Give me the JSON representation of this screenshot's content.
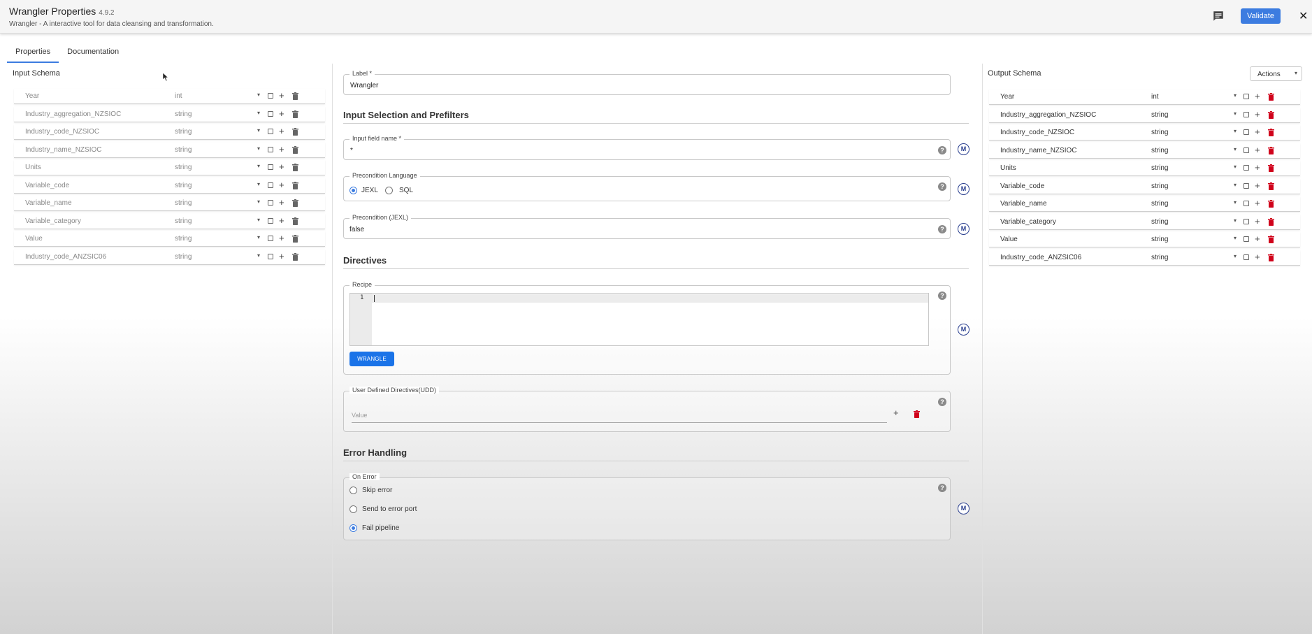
{
  "header": {
    "title": "Wrangler Properties",
    "version": "4.9.2",
    "subtitle": "Wrangler - A interactive tool for data cleansing and transformation.",
    "validate_label": "Validate",
    "close_label": "✕"
  },
  "tabs": [
    {
      "label": "Properties",
      "active": true
    },
    {
      "label": "Documentation",
      "active": false
    }
  ],
  "input_schema": {
    "title": "Input Schema",
    "rows": [
      {
        "name": "Year",
        "type": "int"
      },
      {
        "name": "Industry_aggregation_NZSIOC",
        "type": "string"
      },
      {
        "name": "Industry_code_NZSIOC",
        "type": "string"
      },
      {
        "name": "Industry_name_NZSIOC",
        "type": "string"
      },
      {
        "name": "Units",
        "type": "string"
      },
      {
        "name": "Variable_code",
        "type": "string"
      },
      {
        "name": "Variable_name",
        "type": "string"
      },
      {
        "name": "Variable_category",
        "type": "string"
      },
      {
        "name": "Value",
        "type": "string"
      },
      {
        "name": "Industry_code_ANZSIC06",
        "type": "string"
      }
    ]
  },
  "output_schema": {
    "title": "Output Schema",
    "actions_label": "Actions",
    "rows": [
      {
        "name": "Year",
        "type": "int"
      },
      {
        "name": "Industry_aggregation_NZSIOC",
        "type": "string"
      },
      {
        "name": "Industry_code_NZSIOC",
        "type": "string"
      },
      {
        "name": "Industry_name_NZSIOC",
        "type": "string"
      },
      {
        "name": "Units",
        "type": "string"
      },
      {
        "name": "Variable_code",
        "type": "string"
      },
      {
        "name": "Variable_name",
        "type": "string"
      },
      {
        "name": "Variable_category",
        "type": "string"
      },
      {
        "name": "Value",
        "type": "string"
      },
      {
        "name": "Industry_code_ANZSIC06",
        "type": "string"
      }
    ]
  },
  "form": {
    "label": {
      "legend": "Label *",
      "value": "Wrangler"
    },
    "input_selection_title": "Input Selection and Prefilters",
    "input_field_name": {
      "legend": "Input field name *",
      "value": "*"
    },
    "precondition_language": {
      "legend": "Precondition Language",
      "options": [
        "JEXL",
        "SQL"
      ],
      "selected": "JEXL"
    },
    "precondition_jexl": {
      "legend": "Precondition (JEXL)",
      "value": "false"
    },
    "directives_title": "Directives",
    "recipe": {
      "legend": "Recipe",
      "line_number": "1",
      "wrangle_label": "WRANGLE"
    },
    "udd": {
      "legend": "User Defined Directives(UDD)",
      "placeholder": "Value"
    },
    "error_handling_title": "Error Handling",
    "on_error": {
      "legend": "On Error",
      "options": [
        "Skip error",
        "Send to error port",
        "Fail pipeline"
      ],
      "selected": "Fail pipeline"
    },
    "help_glyph": "?",
    "macro_glyph": "M"
  },
  "colors": {
    "accent": "#3c7ce0",
    "delete_red": "#d0021b",
    "macro_blue": "#2a3f8f"
  }
}
